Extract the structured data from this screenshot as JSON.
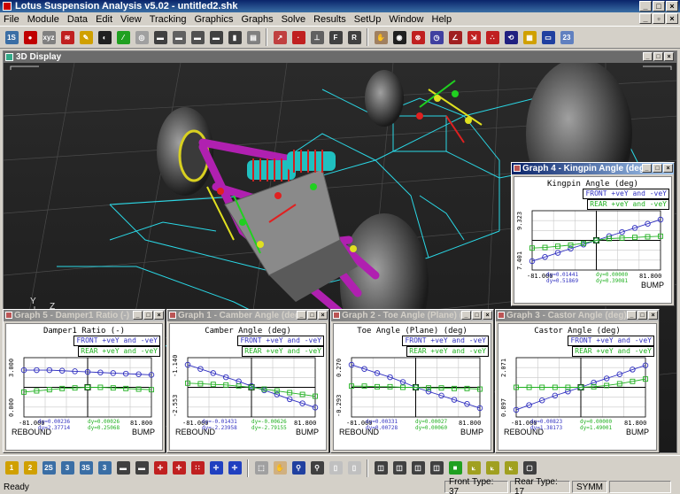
{
  "app": {
    "title": "Lotus Suspension Analysis v5.02 - untitled2.shk"
  },
  "menu": [
    "File",
    "Module",
    "Data",
    "Edit",
    "View",
    "Tracking",
    "Graphics",
    "Graphs",
    "Solve",
    "Results",
    "SetUp",
    "Window",
    "Help"
  ],
  "toolbar_top": [
    {
      "icon": "steps-icon",
      "color": "#3a6ea5",
      "glyph": "1S"
    },
    {
      "icon": "record-icon",
      "color": "#c00000",
      "glyph": "●"
    },
    {
      "icon": "xyz-icon",
      "color": "#808080",
      "glyph": "xyz"
    },
    {
      "icon": "spring-icon",
      "color": "#c02020",
      "glyph": "≋"
    },
    {
      "icon": "pen-icon",
      "color": "#d0a000",
      "glyph": "✎"
    },
    {
      "icon": "wheel-icon",
      "color": "#202020",
      "glyph": "◐"
    },
    {
      "icon": "link-icon",
      "color": "#20a020",
      "glyph": "⁄"
    },
    {
      "icon": "eye-icon",
      "color": "#a0a0a0",
      "glyph": "◎"
    },
    {
      "icon": "car-icon",
      "color": "#404040",
      "glyph": "▬"
    },
    {
      "icon": "car-rear-icon",
      "color": "#606060",
      "glyph": "▬"
    },
    {
      "icon": "car-top-icon",
      "color": "#505050",
      "glyph": "▬"
    },
    {
      "icon": "car-side-icon",
      "color": "#404040",
      "glyph": "▬"
    },
    {
      "icon": "chassis-icon",
      "color": "#404040",
      "glyph": "▮"
    },
    {
      "icon": "print-icon",
      "color": "#808080",
      "glyph": "▤"
    },
    {
      "icon": "graph-icon",
      "color": "#c04040",
      "glyph": "↗"
    },
    {
      "icon": "point-icon",
      "color": "#c02020",
      "glyph": "·"
    },
    {
      "icon": "axis-icon",
      "color": "#606060",
      "glyph": "⊥"
    },
    {
      "icon": "front-icon",
      "color": "#404040",
      "glyph": "F"
    },
    {
      "icon": "rear-icon",
      "color": "#404040",
      "glyph": "R"
    },
    {
      "icon": "hand-icon",
      "color": "#a08060",
      "glyph": "✋"
    },
    {
      "icon": "tyre-icon",
      "color": "#202020",
      "glyph": "◉"
    },
    {
      "icon": "steer-icon",
      "color": "#c02020",
      "glyph": "⊗"
    },
    {
      "icon": "clock-icon",
      "color": "#4040a0",
      "glyph": "◷"
    },
    {
      "icon": "camber-icon",
      "color": "#a02020",
      "glyph": "∠"
    },
    {
      "icon": "move-icon",
      "color": "#c02020",
      "glyph": "⇲"
    },
    {
      "icon": "nodes-icon",
      "color": "#c02020",
      "glyph": "∴"
    },
    {
      "icon": "rotate-icon",
      "color": "#202080",
      "glyph": "⟲"
    },
    {
      "icon": "printer-icon",
      "color": "#d0a000",
      "glyph": "▦"
    },
    {
      "icon": "monitor-icon",
      "color": "#2040a0",
      "glyph": "▭"
    },
    {
      "icon": "grid-icon",
      "color": "#6080c0",
      "glyph": "23"
    }
  ],
  "display": {
    "title": "3D Display",
    "axis_y": "Y",
    "axis_z": "Z",
    "axis_x": "X"
  },
  "graphs": [
    {
      "window_title": "Graph 4 - Kingpin Angle (deg)",
      "name": "Kingpin Angle (deg)",
      "legend_front": "FRONT +veY and -veY",
      "legend_rear": "REAR +veY and -veY",
      "y_max": "9.323",
      "y_min": "7.401",
      "x_min": "-81.000",
      "x_max": "81.800",
      "x_left_label": "",
      "x_right_label": "BUMP",
      "dy_front": "dy=0.01441",
      "dy_rear": "dy=0.00000",
      "dy_front2": "dy=0.51869",
      "dy_rear2": "dy=0.39081",
      "front": [
        0.15,
        0.22,
        0.29,
        0.36,
        0.43,
        0.5,
        0.57,
        0.64,
        0.71,
        0.78,
        0.85
      ],
      "rear": [
        0.37,
        0.38,
        0.4,
        0.42,
        0.45,
        0.5,
        0.53,
        0.54,
        0.55,
        0.56,
        0.57
      ]
    },
    {
      "window_title": "Graph 5 - Damper1 Ratio (-)",
      "name": "Damper1 Ratio (-)",
      "legend_front": "FRONT +veY and -veY",
      "legend_rear": "REAR +veY and -veY",
      "y_max": "3.000",
      "y_min": "0.000",
      "x_min": "-81.000",
      "x_max": "81.800",
      "x_left_label": "REBOUND",
      "x_right_label": "BUMP",
      "dy_front": "dy=0.00236",
      "dy_rear": "dy=0.00026",
      "dy_front2": "dy=2.37714",
      "dy_rear2": "dy=0.25068",
      "front": [
        0.79,
        0.79,
        0.79,
        0.78,
        0.77,
        0.76,
        0.75,
        0.74,
        0.73,
        0.72,
        0.71
      ],
      "rear": [
        0.42,
        0.44,
        0.46,
        0.48,
        0.49,
        0.5,
        0.5,
        0.49,
        0.48,
        0.47,
        0.46
      ]
    },
    {
      "window_title": "Graph 1 - Camber Angle (deg)",
      "name": "Camber Angle (deg)",
      "legend_front": "FRONT +veY and -veY",
      "legend_rear": "REAR +veY and -veY",
      "y_max": "-1.140",
      "y_min": "-2.553",
      "x_min": "-81.000",
      "x_max": "81.800",
      "x_left_label": "REBOUND",
      "x_right_label": "BUMP",
      "dy_front": "dy=-0.01431",
      "dy_rear": "dy=-0.00626",
      "dy_front2": "dy=-2.23958",
      "dy_rear2": "dy=-2.79155",
      "front": [
        0.88,
        0.81,
        0.74,
        0.67,
        0.6,
        0.52,
        0.45,
        0.38,
        0.3,
        0.23,
        0.16
      ],
      "rear": [
        0.57,
        0.56,
        0.55,
        0.54,
        0.52,
        0.5,
        0.47,
        0.44,
        0.41,
        0.38,
        0.35
      ]
    },
    {
      "window_title": "Graph 2 - Toe Angle (Plane) (deg)",
      "name": "Toe Angle (Plane) (deg)",
      "legend_front": "FRONT +veY and -veY",
      "legend_rear": "REAR +veY and -veY",
      "y_max": "0.270",
      "y_min": "-0.293",
      "x_min": "-81.000",
      "x_max": "81.800",
      "x_left_label": "REBOUND",
      "x_right_label": "BUMP",
      "dy_front": "dy=0.00331",
      "dy_rear": "dy=0.00027",
      "dy_front2": "dy=0.00728",
      "dy_rear2": "dy=0.00060",
      "front": [
        0.88,
        0.81,
        0.74,
        0.67,
        0.59,
        0.5,
        0.43,
        0.36,
        0.29,
        0.22,
        0.15
      ],
      "rear": [
        0.52,
        0.52,
        0.51,
        0.51,
        0.5,
        0.5,
        0.49,
        0.49,
        0.48,
        0.48,
        0.47
      ]
    },
    {
      "window_title": "Graph 3 - Castor Angle (deg)",
      "name": "Castor Angle (deg)",
      "legend_front": "FRONT +veY and -veY",
      "legend_rear": "REAR +veY and -veY",
      "y_max": "2.071",
      "y_min": "0.897",
      "x_min": "-81.000",
      "x_max": "81.800",
      "x_left_label": "REBOUND",
      "x_right_label": "BUMP",
      "dy_front": "dy=0.00823",
      "dy_rear": "dy=0.00000",
      "dy_front2": "dy=1.38173",
      "dy_rear2": "dy=1.49001",
      "front": [
        0.12,
        0.2,
        0.28,
        0.36,
        0.43,
        0.5,
        0.58,
        0.65,
        0.72,
        0.8,
        0.87
      ],
      "rear": [
        0.5,
        0.5,
        0.5,
        0.5,
        0.5,
        0.5,
        0.51,
        0.53,
        0.56,
        0.6,
        0.64
      ]
    }
  ],
  "toolbar_bottom": [
    {
      "icon": "view-1-icon",
      "color": "#d0a000",
      "glyph": "1"
    },
    {
      "icon": "view-2-icon",
      "color": "#d0a000",
      "glyph": "2"
    },
    {
      "icon": "view-2s-icon",
      "color": "#3a6ea5",
      "glyph": "2S"
    },
    {
      "icon": "view-3-icon",
      "color": "#3a6ea5",
      "glyph": "3"
    },
    {
      "icon": "view-3s-icon",
      "color": "#3a6ea5",
      "glyph": "3S"
    },
    {
      "icon": "view-3b-icon",
      "color": "#3a6ea5",
      "glyph": "3"
    },
    {
      "icon": "car-front-icon",
      "color": "#404040",
      "glyph": "▬"
    },
    {
      "icon": "car-rear2-icon",
      "color": "#404040",
      "glyph": "▬"
    },
    {
      "icon": "move-xy-icon",
      "color": "#c02020",
      "glyph": "✛"
    },
    {
      "icon": "move-z-icon",
      "color": "#c02020",
      "glyph": "✛"
    },
    {
      "icon": "scatter-icon",
      "color": "#c02020",
      "glyph": "∷"
    },
    {
      "icon": "pan-icon",
      "color": "#2040c0",
      "glyph": "✛"
    },
    {
      "icon": "pan2-icon",
      "color": "#2040c0",
      "glyph": "✛"
    },
    {
      "icon": "select-icon",
      "color": "#a0a0a0",
      "glyph": "⬚"
    },
    {
      "icon": "hand-pan-icon",
      "color": "#d0b080",
      "glyph": "✋"
    },
    {
      "icon": "zoom-icon",
      "color": "#2040a0",
      "glyph": "⚲"
    },
    {
      "icon": "zoom-out-icon",
      "color": "#404040",
      "glyph": "⚲"
    },
    {
      "icon": "page-icon",
      "color": "#c0c0c0",
      "glyph": "▯"
    },
    {
      "icon": "page2-icon",
      "color": "#c0c0c0",
      "glyph": "▯"
    },
    {
      "icon": "cube-icon",
      "color": "#404040",
      "glyph": "◫"
    },
    {
      "icon": "cube2-icon",
      "color": "#404040",
      "glyph": "◫"
    },
    {
      "icon": "cube3-icon",
      "color": "#404040",
      "glyph": "◫"
    },
    {
      "icon": "cube4-icon",
      "color": "#404040",
      "glyph": "◫"
    },
    {
      "icon": "cube-solid-icon",
      "color": "#20a020",
      "glyph": "■"
    },
    {
      "icon": "axes-icon",
      "color": "#a0a020",
      "glyph": "⟀"
    },
    {
      "icon": "axes2-icon",
      "color": "#a0a020",
      "glyph": "⟀"
    },
    {
      "icon": "axes3-icon",
      "color": "#a0a020",
      "glyph": "⟀"
    },
    {
      "icon": "window-icon",
      "color": "#404040",
      "glyph": "▢"
    }
  ],
  "status": {
    "ready": "Ready",
    "front_type": "Front Type: 37",
    "rear_type": "Rear Type: 17",
    "symm": "SYMM"
  },
  "colors": {
    "front": "#3030c0",
    "rear": "#20b020",
    "wireframe": "#2ad8e6",
    "links": "#b020b0"
  }
}
